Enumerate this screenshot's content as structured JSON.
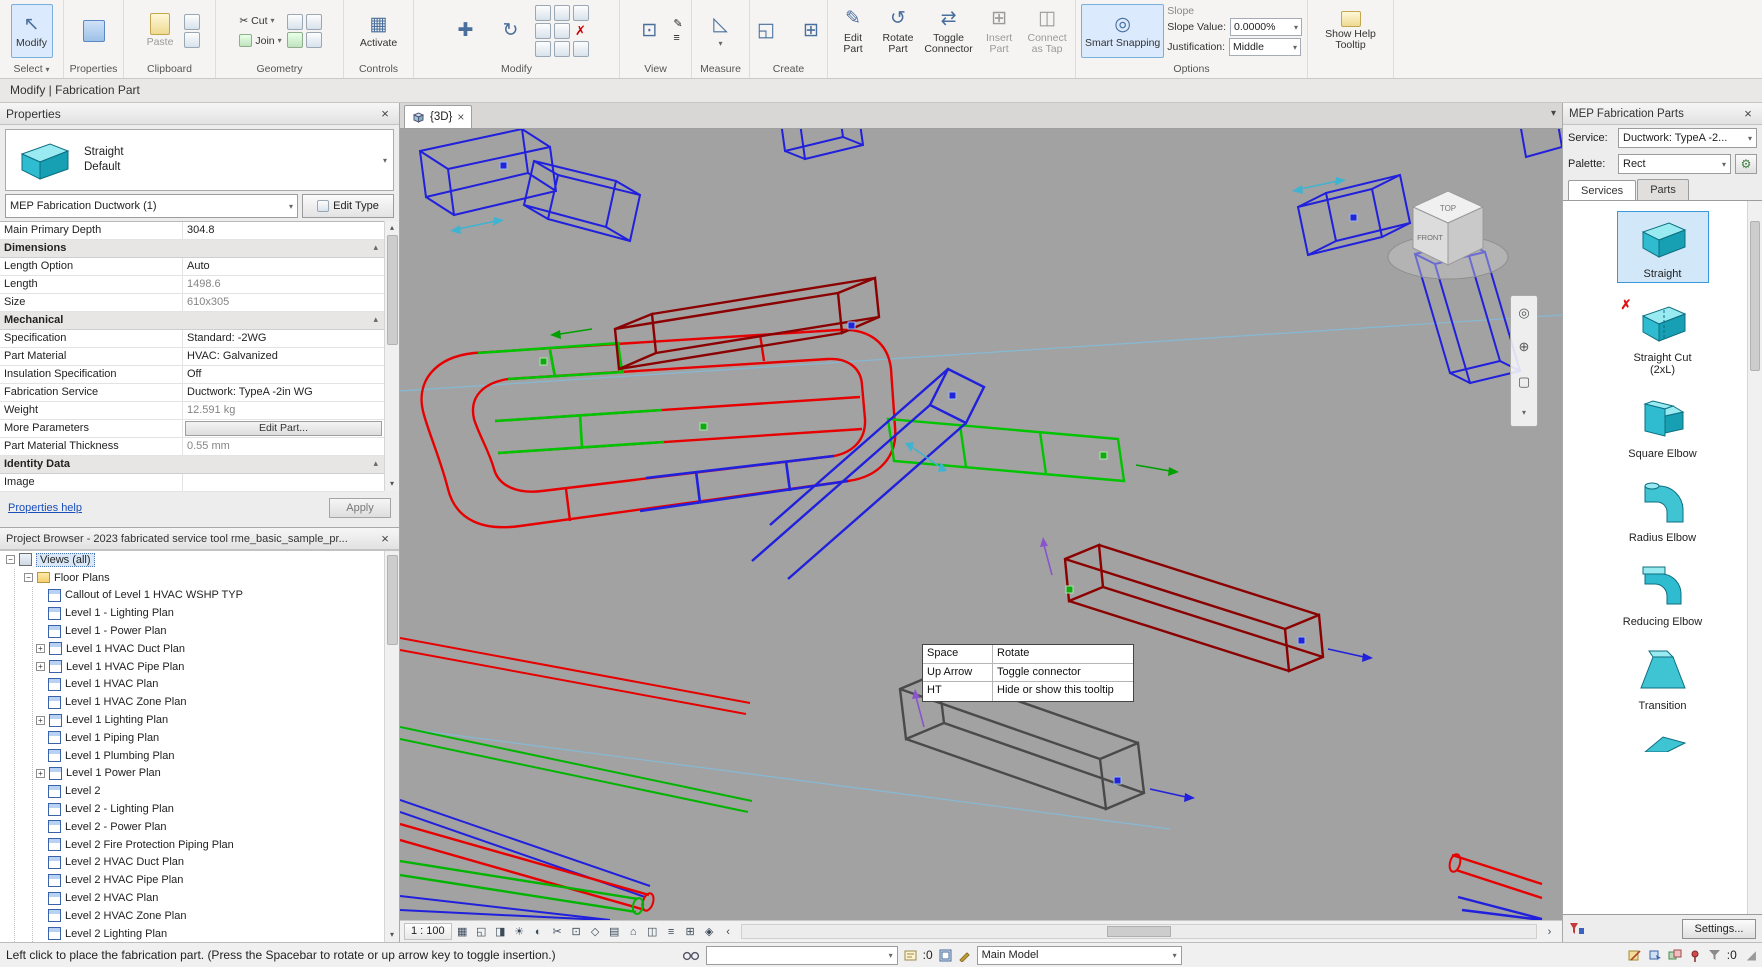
{
  "glyphs": {
    "caret": "▾",
    "caret_up": "▴",
    "close": "×",
    "plus": "+",
    "scroll_up": "▲",
    "scroll_down": "▼",
    "chev_left": "‹",
    "chev_right": "›",
    "scissors": "✂",
    "pencil": "✎",
    "rotate_cw": "↻",
    "rotate_ccw": "↺",
    "swap": "⇄",
    "red_x": "✗",
    "move": "✚",
    "cursor": "↖",
    "gear": "⚙",
    "grip": "◢",
    "measure": "◺",
    "create": "◱",
    "insert": "⊞",
    "tap": "◫",
    "snap": "◎",
    "view": "⊡",
    "activate": "▦",
    "menu": "≡"
  },
  "ribbon": {
    "modify_btn": "Modify",
    "select_label": "Select",
    "properties_label": "Properties",
    "paste": "Paste",
    "clipboard_label": "Clipboard",
    "cut": "Cut",
    "join": "Join",
    "geometry_label": "Geometry",
    "activate": "Activate",
    "controls_label": "Controls",
    "modify_label": "Modify",
    "view_label": "View",
    "measure_label": "Measure",
    "create_label": "Create",
    "edit_part": "Edit Part",
    "rotate_part": "Rotate Part",
    "toggle_connector": "Toggle Connector",
    "insert_part": "Insert Part",
    "connect_tap": "Connect as Tap",
    "smart_snapping": "Smart Snapping",
    "options_label": "Options",
    "slope_partial": "Slope",
    "slope_value_label": "Slope Value:",
    "slope_value": "0.0000%",
    "justification_label": "Justification:",
    "justification_value": "Middle",
    "show_help": "Show Help Tooltip",
    "context_tab": "Modify | Fabrication Part"
  },
  "properties": {
    "title": "Properties",
    "type_name": "Straight",
    "type_sub": "Default",
    "family_selector": "MEP Fabrication Ductwork (1)",
    "edit_type": "Edit Type",
    "rows": [
      {
        "label": "Main Primary Depth",
        "value": "304.8"
      },
      {
        "label": "Dimensions",
        "value": ""
      },
      {
        "label": "Length Option",
        "value": "Auto"
      },
      {
        "label": "Length",
        "value": "1498.6"
      },
      {
        "label": "Size",
        "value": "610x305"
      },
      {
        "label": "Mechanical",
        "value": ""
      },
      {
        "label": "Specification",
        "value": "Standard: -2WG"
      },
      {
        "label": "Part Material",
        "value": "HVAC: Galvanized"
      },
      {
        "label": "Insulation Specification",
        "value": "Off"
      },
      {
        "label": "Fabrication Service",
        "value": "Ductwork: TypeA -2in WG"
      },
      {
        "label": "Weight",
        "value": "12.591 kg"
      },
      {
        "label": "More Parameters",
        "value": "Edit Part..."
      },
      {
        "label": "Part Material Thickness",
        "value": "0.55 mm"
      },
      {
        "label": "Identity Data",
        "value": ""
      },
      {
        "label": "Image",
        "value": ""
      }
    ],
    "help_link": "Properties help",
    "apply": "Apply"
  },
  "browser": {
    "title": "Project Browser - 2023 fabricated service tool rme_basic_sample_pr...",
    "root": "Views (all)",
    "group": "Floor Plans",
    "items": [
      "Callout of Level 1 HVAC WSHP TYP",
      "Level 1 - Lighting Plan",
      "Level 1 - Power Plan",
      "Level 1 HVAC Duct Plan",
      "Level 1 HVAC Pipe Plan",
      "Level 1 HVAC Plan",
      "Level 1 HVAC Zone Plan",
      "Level 1 Lighting Plan",
      "Level 1 Piping Plan",
      "Level 1 Plumbing Plan",
      "Level 1 Power Plan",
      "Level 2",
      "Level 2 - Lighting Plan",
      "Level 2 - Power Plan",
      "Level 2 Fire Protection Piping Plan",
      "Level 2 HVAC Duct Plan",
      "Level 2 HVAC Pipe Plan",
      "Level 2 HVAC Plan",
      "Level 2 HVAC Zone Plan",
      "Level 2 Lighting Plan"
    ]
  },
  "viewport": {
    "tab": "{3D}",
    "scale": "1 : 100",
    "viewcube": {
      "top": "TOP",
      "front": "FRONT"
    },
    "tooltip": {
      "rows": [
        {
          "key": "Space",
          "action": "Rotate"
        },
        {
          "key": "Up Arrow",
          "action": "Toggle connector"
        },
        {
          "key": "HT",
          "action": "Hide or show this tooltip"
        }
      ]
    },
    "controls_icons": [
      "▦",
      "◱",
      "◨",
      "☀",
      "◐",
      "✂",
      "⊡",
      "◇",
      "▤",
      "⌂",
      "◫",
      "≡",
      "⊞",
      "◈"
    ]
  },
  "fab": {
    "title": "MEP Fabrication Parts",
    "service_label": "Service:",
    "service_value": "Ductwork: TypeA -2...",
    "palette_label": "Palette:",
    "palette_value": "Rect",
    "tab_services": "Services",
    "tab_parts": "Parts",
    "parts": [
      {
        "label": "Straight"
      },
      {
        "label": "Straight Cut (2xL)"
      },
      {
        "label": "Square Elbow"
      },
      {
        "label": "Radius Elbow"
      },
      {
        "label": "Reducing Elbow"
      },
      {
        "label": "Transition"
      }
    ],
    "settings": "Settings..."
  },
  "statusbar": {
    "message": "Left click to place the fabrication part. (Press the Spacebar to rotate or up arrow key to toggle insertion.)",
    "requests": ":0",
    "main_model": "Main Model",
    "filter_count": ":0"
  },
  "colors": {
    "accent": "#3a96dd",
    "duct_red": "#e60000",
    "duct_green": "#00c400",
    "duct_blue": "#2020dd",
    "duct_darkred": "#8b0000",
    "pending_gray": "#4a4a4a",
    "part_icon_teal": "#3fc4d4",
    "canvas_gray": "#a2a2a2"
  }
}
